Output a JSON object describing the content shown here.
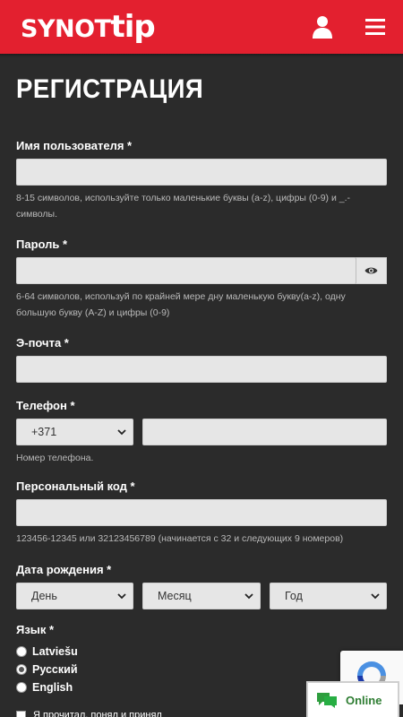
{
  "header": {
    "logo_part1": "SYNOT",
    "logo_part2": "tip",
    "user_icon": "user-icon",
    "menu_icon": "hamburger-menu-icon",
    "brand_color": "#e3202f"
  },
  "page": {
    "title": "РЕГИСТРАЦИЯ"
  },
  "form": {
    "username": {
      "label": "Имя пользователя *",
      "value": "",
      "hint": "8-15 символов, используйте только маленькие буквы (a-z), цифры (0-9) и _.-символы."
    },
    "password": {
      "label": "Пароль *",
      "value": "",
      "toggle_icon": "eye-icon",
      "hint": "6-64 символов, используй по крайней мере дну маленькую букву(a-z), одну большую букву (A-Z) и цифры (0-9)"
    },
    "email": {
      "label": "Э-почта *",
      "value": ""
    },
    "phone": {
      "label": "Телефон *",
      "country_code": "+371",
      "value": "",
      "hint": "Номер телефона."
    },
    "personal_code": {
      "label": "Персональный код *",
      "value": "",
      "hint": "123456-12345 или 32123456789 (начинается с 32 и следующих 9 номеров)"
    },
    "birthdate": {
      "label": "Дата рождения *",
      "day": "День",
      "month": "Месяц",
      "year": "Год"
    },
    "language": {
      "label": "Язык *",
      "options": [
        {
          "label": "Latviešu",
          "checked": false
        },
        {
          "label": "Русский",
          "checked": true
        },
        {
          "label": "English",
          "checked": false
        }
      ]
    },
    "consent_text": "Я прочитал, понял и принял"
  },
  "widgets": {
    "online_chat_label": "Online",
    "chat_icon": "chat-bubbles-icon",
    "recaptcha_icon": "recaptcha-icon"
  }
}
